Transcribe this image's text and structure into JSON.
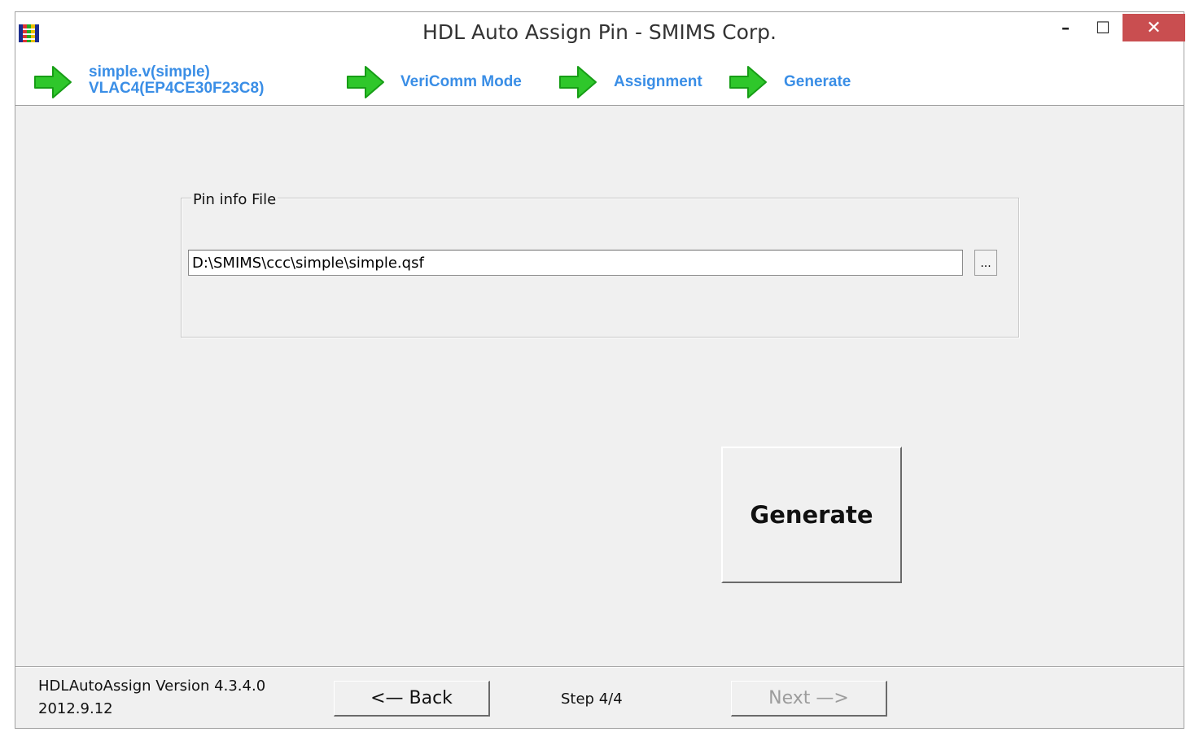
{
  "window": {
    "title": "HDL Auto Assign Pin - SMIMS Corp.",
    "controls": {
      "minimize": "–",
      "maximize": "☐",
      "close": "✕"
    }
  },
  "steps": [
    {
      "label_line1": "simple.v(simple)",
      "label_line2": "VLAC4(EP4CE30F23C8)"
    },
    {
      "label": "VeriComm Mode"
    },
    {
      "label": "Assignment"
    },
    {
      "label": "Generate"
    }
  ],
  "pin_info": {
    "legend": "Pin info File",
    "path": "D:\\SMIMS\\ccc\\simple\\simple.qsf",
    "browse_label": "..."
  },
  "generate_button": "Generate",
  "footer": {
    "version": "HDLAutoAssign Version 4.3.4.0",
    "date": "2012.9.12",
    "back_label": "<—  Back",
    "step_text": "Step 4/4",
    "next_label": "Next  —>"
  },
  "colors": {
    "step_text": "#3a8ee6",
    "arrow_green": "#2fc72b",
    "close_button": "#c94e50",
    "window_bg": "#f0f0f0"
  },
  "icons": {
    "app": "app-icon",
    "step": "green-arrow-icon"
  }
}
